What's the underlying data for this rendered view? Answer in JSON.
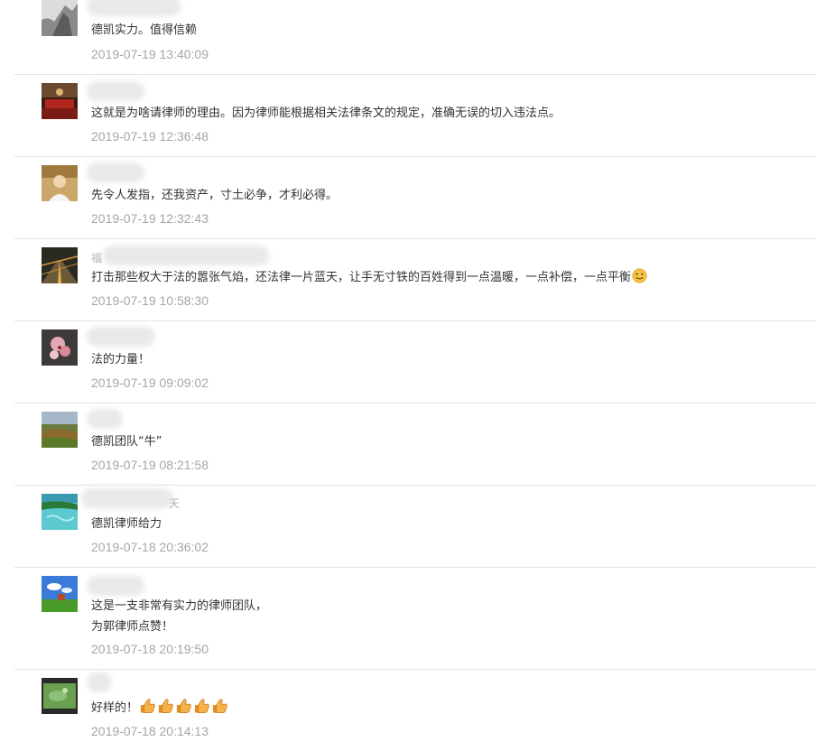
{
  "comments": [
    {
      "text": "德凯实力。值得信赖",
      "time": "2019-07-19 13:40:09",
      "avatar": "grey-ghost-avatar"
    },
    {
      "text": "这就是为啥请律师的理由。因为律师能根据相关法律条文的规定，准确无误的切入违法点。",
      "time": "2019-07-19 12:36:48",
      "avatar": "red-hall-avatar"
    },
    {
      "text": "先令人发指，还我资产，寸土必争，才利必得。",
      "time": "2019-07-19 12:32:43",
      "avatar": "portrait-avatar"
    },
    {
      "name_char": "福",
      "text": "打击那些权大于法的嚣张气焰，还法律一片蓝天，让手无寸铁的百姓得到一点温暖，一点补偿，一点平衡",
      "time": "2019-07-19 10:58:30",
      "avatar": "night-road-avatar",
      "emoji": "smile-emoji"
    },
    {
      "text": "法的力量！",
      "time": "2019-07-19 09:09:02",
      "avatar": "flower-avatar"
    },
    {
      "text": "德凯团队“牛”",
      "time": "2019-07-19 08:21:58",
      "avatar": "landscape-avatar"
    },
    {
      "name_char": "天",
      "text": "德凯律师给力",
      "time": "2019-07-18 20:36:02",
      "avatar": "lagoon-avatar"
    },
    {
      "text_lines": [
        "这是一支非常有实力的律师团队，",
        "为郭律师点赞！"
      ],
      "time": "2019-07-18 20:19:50",
      "avatar": "blue-sky-avatar"
    },
    {
      "text": "好样的！",
      "time": "2019-07-18 20:14:13",
      "avatar": "green-field-avatar",
      "emoji": "thumbs-up-emoji",
      "emoji_count": 5
    }
  ],
  "colors": {
    "text": "#333333",
    "time": "#a6a6a6",
    "divider": "#e3e3e3"
  }
}
